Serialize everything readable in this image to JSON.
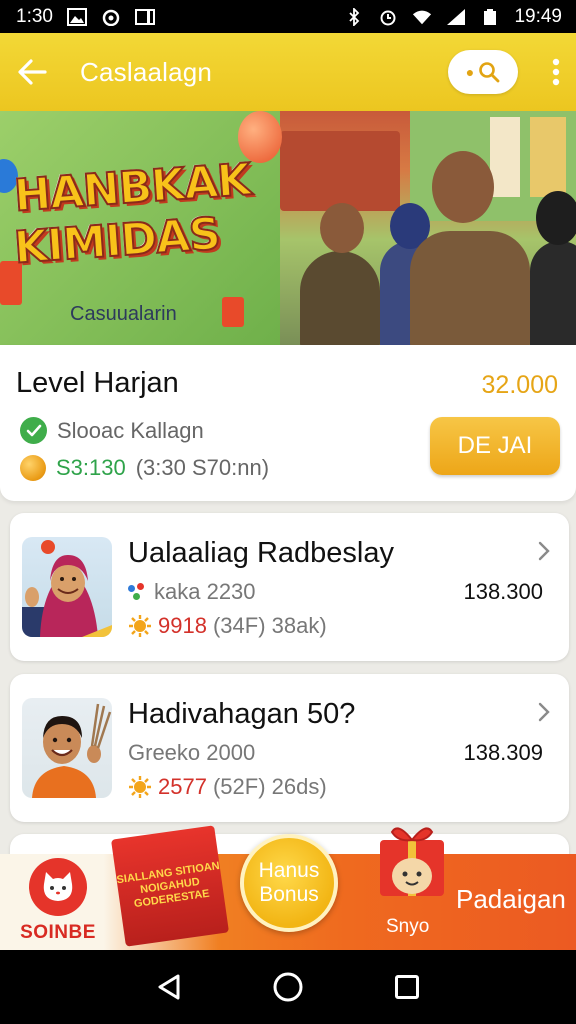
{
  "status_bar": {
    "time_left": "1:30",
    "time_right": "19:49"
  },
  "app_bar": {
    "title": "Caslaalagn"
  },
  "banner": {
    "logo_line1": "HANBKAK",
    "logo_line2": "KIMIDAS",
    "subtitle": "Casuualarin"
  },
  "level_card": {
    "title": "Level Harjan",
    "amount": "32.000",
    "status_text": "Slooac Kallagn",
    "coin_value": "S3:130",
    "coin_detail": "(3:30  S70:nn)",
    "action_label": "DE JAI"
  },
  "list": [
    {
      "title": "Ualaaliag Radbeslay",
      "subtitle": "kaka 2230",
      "points": "9918",
      "points_detail": "(34F)  38ak)",
      "amount": "138.300"
    },
    {
      "title": "Hadivahagan 50?",
      "subtitle": "Greeko  2000",
      "points": "2577",
      "points_detail": "(52F)  26ds)",
      "amount": "138.309"
    }
  ],
  "promo_bar": {
    "brand_label": "SOINBE",
    "gift_text": "SIALLANG SITIOAN NOIGAHUD GODERESTAE",
    "bonus_line1": "Hanus",
    "bonus_line2": "Bonus",
    "gift2_label": "Snyo",
    "cta_label": "Padaigan"
  },
  "colors": {
    "app_bar": "#f0cf2c",
    "accent_orange": "#eda618",
    "green": "#2fa34a",
    "red": "#d3312a"
  }
}
